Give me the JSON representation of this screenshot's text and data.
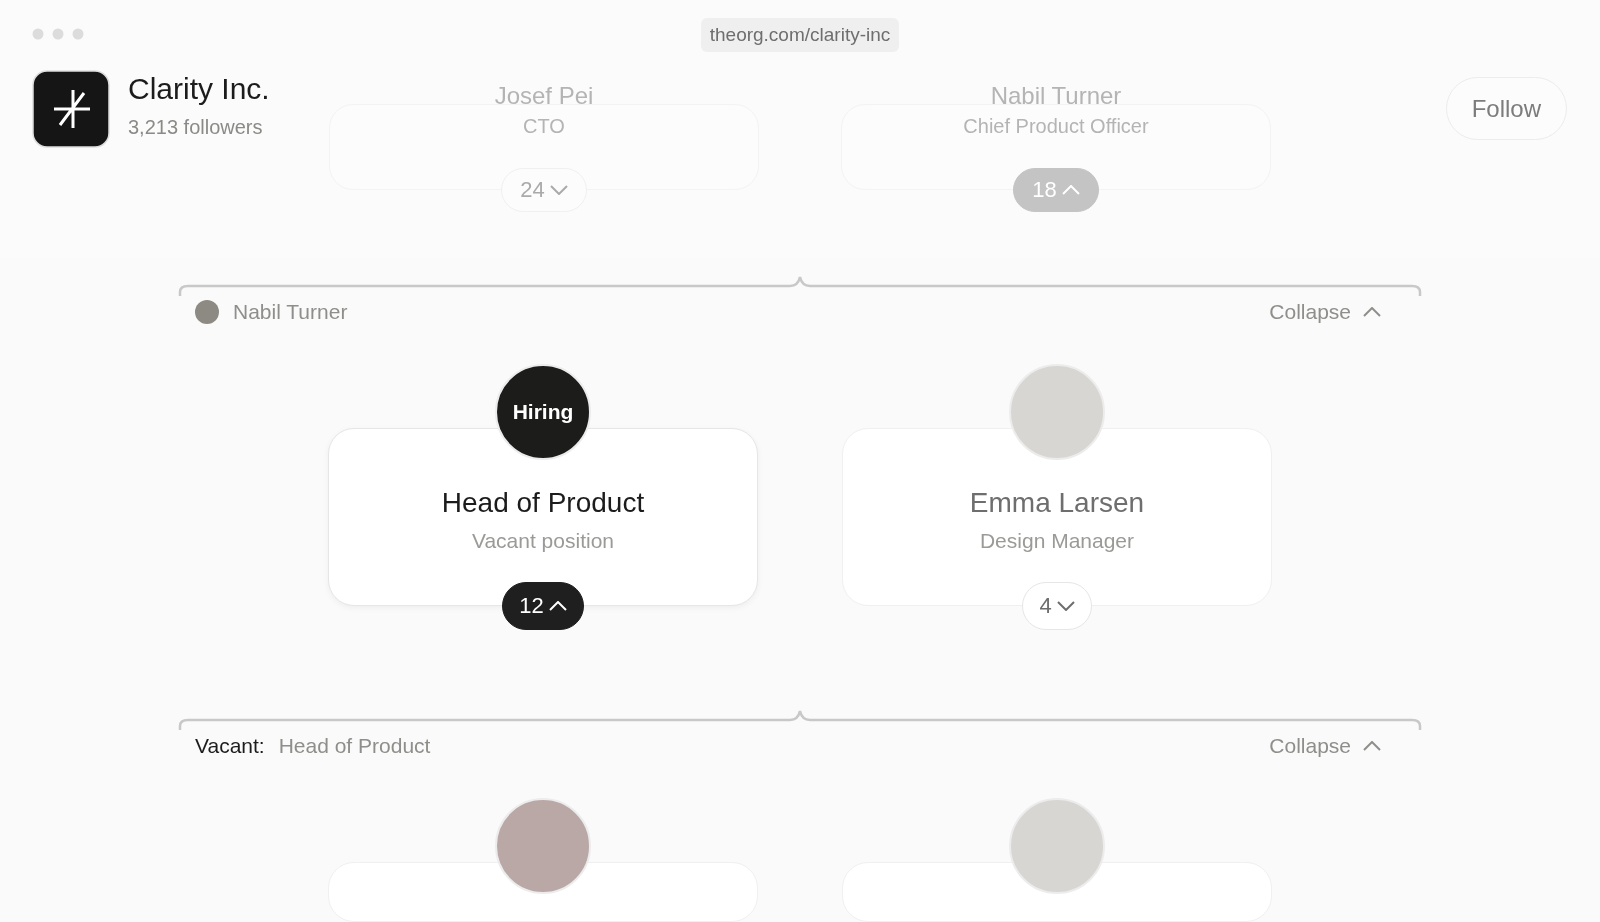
{
  "browser": {
    "url": "theorg.com/clarity-inc"
  },
  "company": {
    "name": "Clarity Inc.",
    "followers": "3,213 followers"
  },
  "follow_button": "Follow",
  "top_cards": [
    {
      "name": "Josef Pei",
      "role": "CTO",
      "count": "24",
      "expanded": false
    },
    {
      "name": "Nabil Turner",
      "role": "Chief Product Officer",
      "count": "18",
      "expanded": true
    }
  ],
  "sections": [
    {
      "manager": {
        "kind": "person",
        "name": "Nabil Turner"
      },
      "collapse": "Collapse",
      "cards": [
        {
          "kind": "vacant",
          "badge": "Hiring",
          "title": "Head of Product",
          "subtitle": "Vacant position",
          "count": "12",
          "expanded": true
        },
        {
          "kind": "person",
          "title": "Emma Larsen",
          "subtitle": "Design Manager",
          "count": "4",
          "expanded": false
        }
      ]
    },
    {
      "manager": {
        "kind": "vacant",
        "label": "Vacant:",
        "name": "Head of Product"
      },
      "collapse": "Collapse",
      "cards": [
        {
          "kind": "person"
        },
        {
          "kind": "person"
        }
      ]
    }
  ]
}
